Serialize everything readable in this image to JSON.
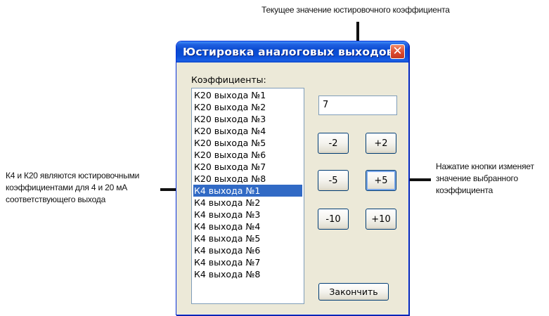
{
  "annotations": {
    "top": "Текущее значение юстировочного коэффициента",
    "left": "К4 и К20 являются юстировочными коэффициентами для 4 и 20 мА соответствующего выхода",
    "right": "Нажатие кнопки изменяет значение выбранного коэффициента"
  },
  "dialog": {
    "title": "Юстировка аналоговых выходов",
    "close_icon": "close-icon",
    "coefficients_label": "Коэффициенты:",
    "items": [
      "К20 выхода №1",
      "К20 выхода №2",
      "К20 выхода №3",
      "К20 выхода №4",
      "К20 выхода №5",
      "К20 выхода №6",
      "К20 выхода №7",
      "К20 выхода №8",
      "К4  выхода №1",
      "К4  выхода №2",
      "К4  выхода №3",
      "К4  выхода №4",
      "К4  выхода №5",
      "К4  выхода №6",
      "К4  выхода №7",
      "К4  выхода №8"
    ],
    "selected_index": 8,
    "current_value": "7",
    "buttons": {
      "minus2": "-2",
      "plus2": "+2",
      "minus5": "-5",
      "plus5": "+5",
      "minus10": "-10",
      "plus10": "+10",
      "finish": "Закончить"
    }
  },
  "colors": {
    "titlebar": "#0a4ad0",
    "selection": "#316ac5",
    "dialog_bg": "#ece9d8"
  }
}
